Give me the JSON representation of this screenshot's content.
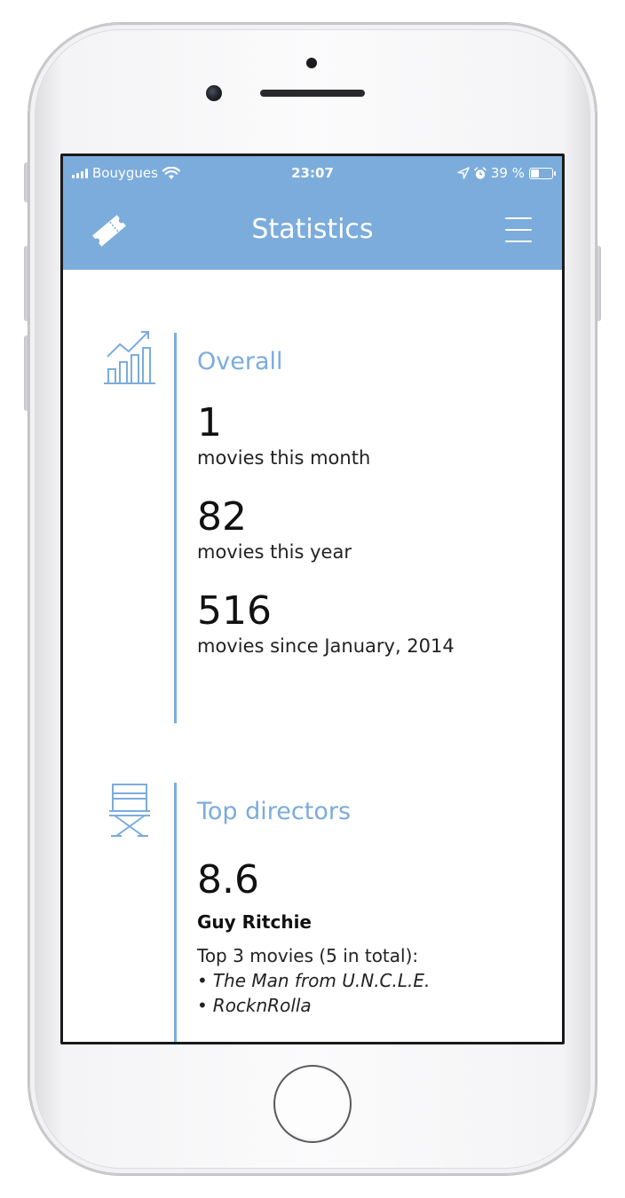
{
  "status_bar": {
    "carrier": "Bouygues",
    "time": "23:07",
    "battery_text": "39 %",
    "battery_level": 0.39
  },
  "nav": {
    "title": "Statistics",
    "left_icon": "ticket-icon",
    "right_icon": "hamburger-menu-icon"
  },
  "overall": {
    "title": "Overall",
    "icon": "growth-chart-icon",
    "stats": [
      {
        "value": "1",
        "label": "movies this month"
      },
      {
        "value": "82",
        "label": "movies this year"
      },
      {
        "value": "516",
        "label": "movies since January, 2014"
      }
    ]
  },
  "top_directors": {
    "title": "Top directors",
    "icon": "director-chair-icon",
    "score": "8.6",
    "name": "Guy Ritchie",
    "movies_intro": "Top 3 movies (5 in total):",
    "movies": [
      "The Man from U.N.C.L.E.",
      "RocknRolla"
    ]
  },
  "colors": {
    "accent": "#7bacdc",
    "text": "#111111"
  }
}
